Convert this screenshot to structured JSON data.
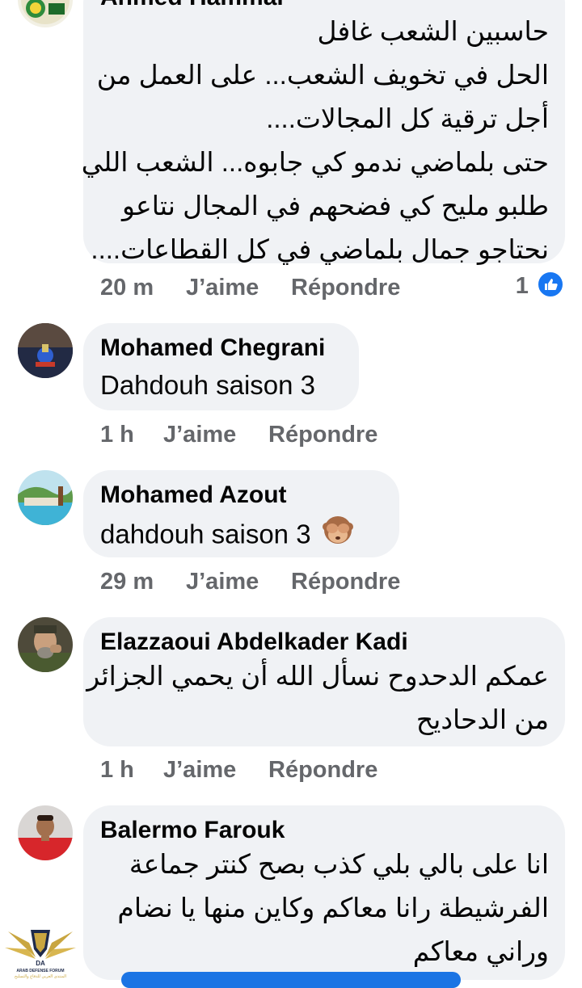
{
  "comments": [
    {
      "author": "Ahmed Hammal",
      "lines": [
        "حاسبين الشعب غافل",
        "الحل في تخويف الشعب... على العمل من",
        "أجل ترقية كل المجالات....",
        "حتى بلماضي ندمو كي جابوه... الشعب اللي",
        "طلبو  مليح كي فضحهم في المجال نتاعو",
        "نحتاجو جمال بلماضي في كل القطاعات...."
      ],
      "time": "20 m",
      "like_label": "J’aime",
      "reply_label": "Répondre",
      "reaction_count": "1"
    },
    {
      "author": "Mohamed Chegrani",
      "text": "Dahdouh saison 3",
      "time": "1 h",
      "like_label": "J’aime",
      "reply_label": "Répondre"
    },
    {
      "author": "Mohamed Azout",
      "text": "dahdouh saison 3",
      "time": "29 m",
      "like_label": "J’aime",
      "reply_label": "Répondre"
    },
    {
      "author": "Elazzaoui Abdelkader Kadi",
      "lines": [
        "عمكم الدحدوح نسأل الله أن يحمي الجزائر",
        "من الدحاديح"
      ],
      "time": "1 h",
      "like_label": "J’aime",
      "reply_label": "Répondre"
    },
    {
      "author": "Balermo Farouk",
      "lines": [
        "انا على بالي بلي كذب بصح كنتر جماعة",
        "الفرشيطة  رانا معاكم وكاين  منها يا نضام",
        "وراني معاكم"
      ]
    }
  ],
  "watermark": {
    "line1": "ARAB DEFENSE FORUM",
    "line2": "المنتدى العربي للدفاع والتسليح",
    "abbr": "DA"
  },
  "colors": {
    "bubble": "#f0f2f5",
    "meta_text": "#65676b",
    "like_blue": "#1877f2"
  }
}
